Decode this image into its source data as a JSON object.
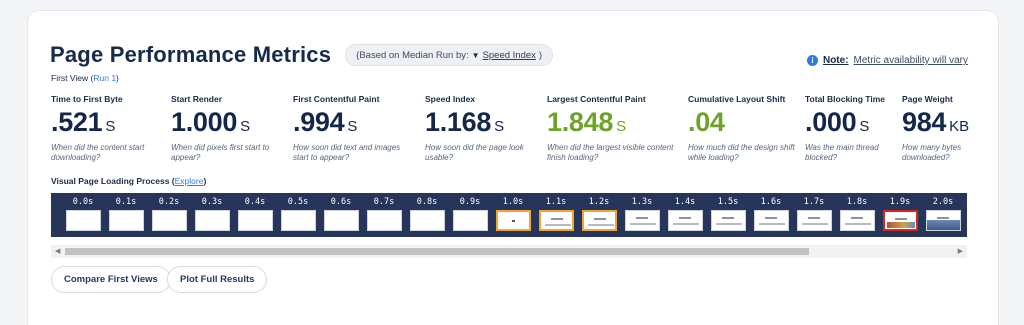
{
  "header": {
    "title": "Page Performance Metrics",
    "run_prefix": "(Based on Median Run by:",
    "run_selected": "Speed Index",
    "run_suffix": ")",
    "note_bold": "Note:",
    "note_text": "Metric availability will vary",
    "first_view_label": "First View (",
    "first_view_link": "Run 1",
    "first_view_close": ")"
  },
  "metrics": [
    {
      "label": "Time to First Byte",
      "value": ".521",
      "unit": "S",
      "desc": "When did the content start downloading?",
      "highlight": false
    },
    {
      "label": "Start Render",
      "value": "1.000",
      "unit": "S",
      "desc": "When did pixels first start to appear?",
      "highlight": false
    },
    {
      "label": "First Contentful Paint",
      "value": ".994",
      "unit": "S",
      "desc": "How soon did text and images start to appear?",
      "highlight": false
    },
    {
      "label": "Speed Index",
      "value": "1.168",
      "unit": "S",
      "desc": "How soon did the page look usable?",
      "highlight": false
    },
    {
      "label": "Largest Contentful Paint",
      "value": "1.848",
      "unit": "S",
      "desc": "When did the largest visible content finish loading?",
      "highlight": true
    },
    {
      "label": "Cumulative Layout Shift",
      "value": ".04",
      "unit": "",
      "desc": "How much did the design shift while loading?",
      "highlight": true
    },
    {
      "label": "Total Blocking Time",
      "value": ".000",
      "unit": "S",
      "desc": "Was the main thread blocked?",
      "highlight": false
    },
    {
      "label": "Page Weight",
      "value": "984",
      "unit": "KB",
      "desc": "How many bytes downloaded?",
      "highlight": false
    }
  ],
  "visual": {
    "label": "Visual Page Loading Process (",
    "link": "Explore",
    "close": ")"
  },
  "filmstrip": [
    {
      "time": "0.0s",
      "state": "blank"
    },
    {
      "time": "0.1s",
      "state": "blank"
    },
    {
      "time": "0.2s",
      "state": "blank"
    },
    {
      "time": "0.3s",
      "state": "blank"
    },
    {
      "time": "0.4s",
      "state": "blank"
    },
    {
      "time": "0.5s",
      "state": "blank"
    },
    {
      "time": "0.6s",
      "state": "blank"
    },
    {
      "time": "0.7s",
      "state": "blank"
    },
    {
      "time": "0.8s",
      "state": "blank"
    },
    {
      "time": "0.9s",
      "state": "blank"
    },
    {
      "time": "1.0s",
      "state": "changed-dot"
    },
    {
      "time": "1.1s",
      "state": "changed-lines"
    },
    {
      "time": "1.2s",
      "state": "changed-lines"
    },
    {
      "time": "1.3s",
      "state": "lines"
    },
    {
      "time": "1.4s",
      "state": "lines"
    },
    {
      "time": "1.5s",
      "state": "lines"
    },
    {
      "time": "1.6s",
      "state": "lines"
    },
    {
      "time": "1.7s",
      "state": "lines"
    },
    {
      "time": "1.8s",
      "state": "lines"
    },
    {
      "time": "1.9s",
      "state": "final"
    },
    {
      "time": "2.0s",
      "state": "complete"
    }
  ],
  "buttons": {
    "compare": "Compare First Views",
    "plot": "Plot Full Results"
  },
  "colors": {
    "title": "#162b4c",
    "good": "#6da32a",
    "link": "#2c7be5",
    "filmstrip_bg": "#263559",
    "changed_frame": "#f2a531",
    "final_frame": "#d9261c"
  }
}
